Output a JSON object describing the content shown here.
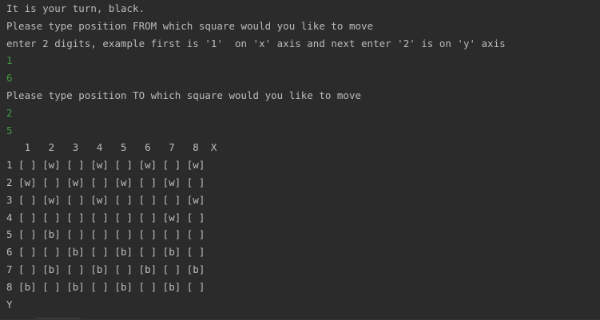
{
  "console": {
    "lines": [
      {
        "text": "It is your turn, black.",
        "type": "output"
      },
      {
        "text": "Please type position FROM which square would you like to move",
        "type": "output"
      },
      {
        "text": "enter 2 digits, example first is '1'  on 'x' axis and next enter '2' is on 'y' axis",
        "type": "output"
      },
      {
        "text": "1",
        "type": "input"
      },
      {
        "text": "6",
        "type": "input"
      },
      {
        "text": "Please type position TO which square would you like to move",
        "type": "output"
      },
      {
        "text": "2",
        "type": "input"
      },
      {
        "text": "5",
        "type": "input"
      },
      {
        "text": "   1   2   3   4   5   6   7   8  X",
        "type": "output"
      },
      {
        "text": "1 [ ] [w] [ ] [w] [ ] [w] [ ] [w]",
        "type": "output"
      },
      {
        "text": "2 [w] [ ] [w] [ ] [w] [ ] [w] [ ]",
        "type": "output"
      },
      {
        "text": "3 [ ] [w] [ ] [w] [ ] [ ] [ ] [w]",
        "type": "output"
      },
      {
        "text": "4 [ ] [ ] [ ] [ ] [ ] [ ] [w] [ ]",
        "type": "output"
      },
      {
        "text": "5 [ ] [b] [ ] [ ] [ ] [ ] [ ] [ ]",
        "type": "output"
      },
      {
        "text": "6 [ ] [ ] [b] [ ] [b] [ ] [b] [ ]",
        "type": "output"
      },
      {
        "text": "7 [ ] [b] [ ] [b] [ ] [b] [ ] [b]",
        "type": "output"
      },
      {
        "text": "8 [b] [ ] [b] [ ] [b] [ ] [b] [ ]",
        "type": "output"
      },
      {
        "text": "Y",
        "type": "output"
      }
    ]
  },
  "colors": {
    "background": "#2b2b2b",
    "output_text": "#bbbbbb",
    "input_text": "#3f9a3f"
  }
}
